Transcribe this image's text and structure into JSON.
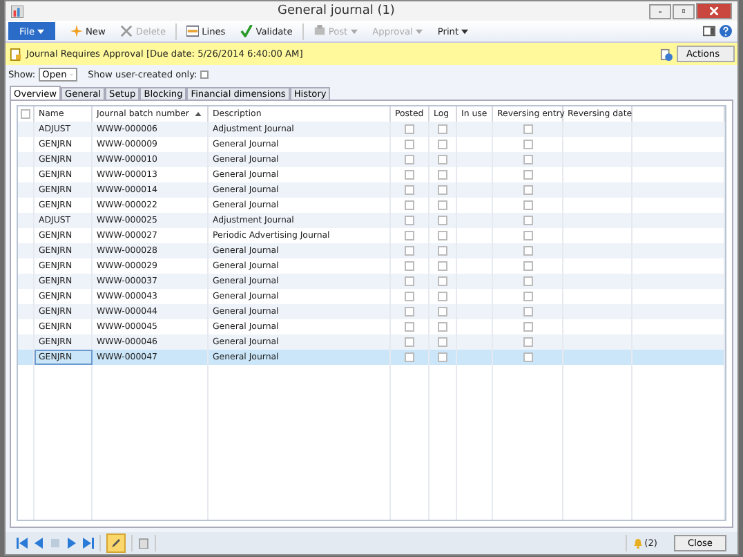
{
  "window": {
    "title": "General journal (1)"
  },
  "toolbar": [
    {
      "kind": "file",
      "label": "File",
      "disabled": false,
      "dropdown": true
    },
    {
      "kind": "new",
      "label": "New",
      "disabled": false,
      "dropdown": false
    },
    {
      "kind": "delete",
      "label": "Delete",
      "disabled": true,
      "dropdown": false
    },
    {
      "kind": "lines",
      "label": "Lines",
      "disabled": false,
      "dropdown": false
    },
    {
      "kind": "validate",
      "label": "Validate",
      "disabled": false,
      "dropdown": false
    },
    {
      "kind": "post",
      "label": "Post",
      "disabled": true,
      "dropdown": true
    },
    {
      "kind": "approval",
      "label": "Approval",
      "disabled": true,
      "dropdown": true
    },
    {
      "kind": "print",
      "label": "Print",
      "disabled": false,
      "dropdown": true
    }
  ],
  "notice": {
    "text": "Journal Requires Approval  [Due date: 5/26/2014 6:40:00 AM]",
    "actions": "Actions"
  },
  "filter": {
    "show_label": "Show:",
    "show_value": "Open",
    "user_created_label": "Show user-created only:",
    "user_created_checked": false
  },
  "tabs": [
    {
      "label": "Overview",
      "selected": true
    },
    {
      "label": "General",
      "selected": false
    },
    {
      "label": "Setup",
      "selected": false
    },
    {
      "label": "Blocking",
      "selected": false
    },
    {
      "label": "Financial dimensions",
      "selected": false
    },
    {
      "label": "History",
      "selected": false
    }
  ],
  "table": {
    "select_all": false,
    "columns": [
      "Name",
      "Journal batch number",
      "Description",
      "Posted",
      "Log",
      "In use",
      "Reversing entry",
      "Reversing date"
    ],
    "rows": [
      {
        "name": "ADJUST",
        "batch": "WWW-000006",
        "description": "Adjustment Journal",
        "posted": false,
        "log": false,
        "reversing_entry": false,
        "selected": false
      },
      {
        "name": "GENJRN",
        "batch": "WWW-000009",
        "description": "General Journal",
        "posted": false,
        "log": false,
        "reversing_entry": false,
        "selected": false
      },
      {
        "name": "GENJRN",
        "batch": "WWW-000010",
        "description": "General Journal",
        "posted": false,
        "log": false,
        "reversing_entry": false,
        "selected": false
      },
      {
        "name": "GENJRN",
        "batch": "WWW-000013",
        "description": "General Journal",
        "posted": false,
        "log": false,
        "reversing_entry": false,
        "selected": false
      },
      {
        "name": "GENJRN",
        "batch": "WWW-000014",
        "description": "General Journal",
        "posted": false,
        "log": false,
        "reversing_entry": false,
        "selected": false
      },
      {
        "name": "GENJRN",
        "batch": "WWW-000022",
        "description": "General Journal",
        "posted": false,
        "log": false,
        "reversing_entry": false,
        "selected": false
      },
      {
        "name": "ADJUST",
        "batch": "WWW-000025",
        "description": "Adjustment Journal",
        "posted": false,
        "log": false,
        "reversing_entry": false,
        "selected": false
      },
      {
        "name": "GENJRN",
        "batch": "WWW-000027",
        "description": "Periodic Advertising  Journal",
        "posted": false,
        "log": false,
        "reversing_entry": false,
        "selected": false
      },
      {
        "name": "GENJRN",
        "batch": "WWW-000028",
        "description": "General Journal",
        "posted": false,
        "log": false,
        "reversing_entry": false,
        "selected": false
      },
      {
        "name": "GENJRN",
        "batch": "WWW-000029",
        "description": "General Journal",
        "posted": false,
        "log": false,
        "reversing_entry": false,
        "selected": false
      },
      {
        "name": "GENJRN",
        "batch": "WWW-000037",
        "description": "General Journal",
        "posted": false,
        "log": false,
        "reversing_entry": false,
        "selected": false
      },
      {
        "name": "GENJRN",
        "batch": "WWW-000043",
        "description": "General Journal",
        "posted": false,
        "log": false,
        "reversing_entry": false,
        "selected": false
      },
      {
        "name": "GENJRN",
        "batch": "WWW-000044",
        "description": "General Journal",
        "posted": false,
        "log": false,
        "reversing_entry": false,
        "selected": false
      },
      {
        "name": "GENJRN",
        "batch": "WWW-000045",
        "description": "General Journal",
        "posted": false,
        "log": false,
        "reversing_entry": false,
        "selected": false
      },
      {
        "name": "GENJRN",
        "batch": "WWW-000046",
        "description": "General Journal",
        "posted": false,
        "log": false,
        "reversing_entry": false,
        "selected": false
      },
      {
        "name": "GENJRN",
        "batch": "WWW-000047",
        "description": "General Journal",
        "posted": false,
        "log": false,
        "reversing_entry": false,
        "selected": true
      }
    ]
  },
  "status_bar": {
    "alerts": "(2)",
    "close": "Close"
  }
}
